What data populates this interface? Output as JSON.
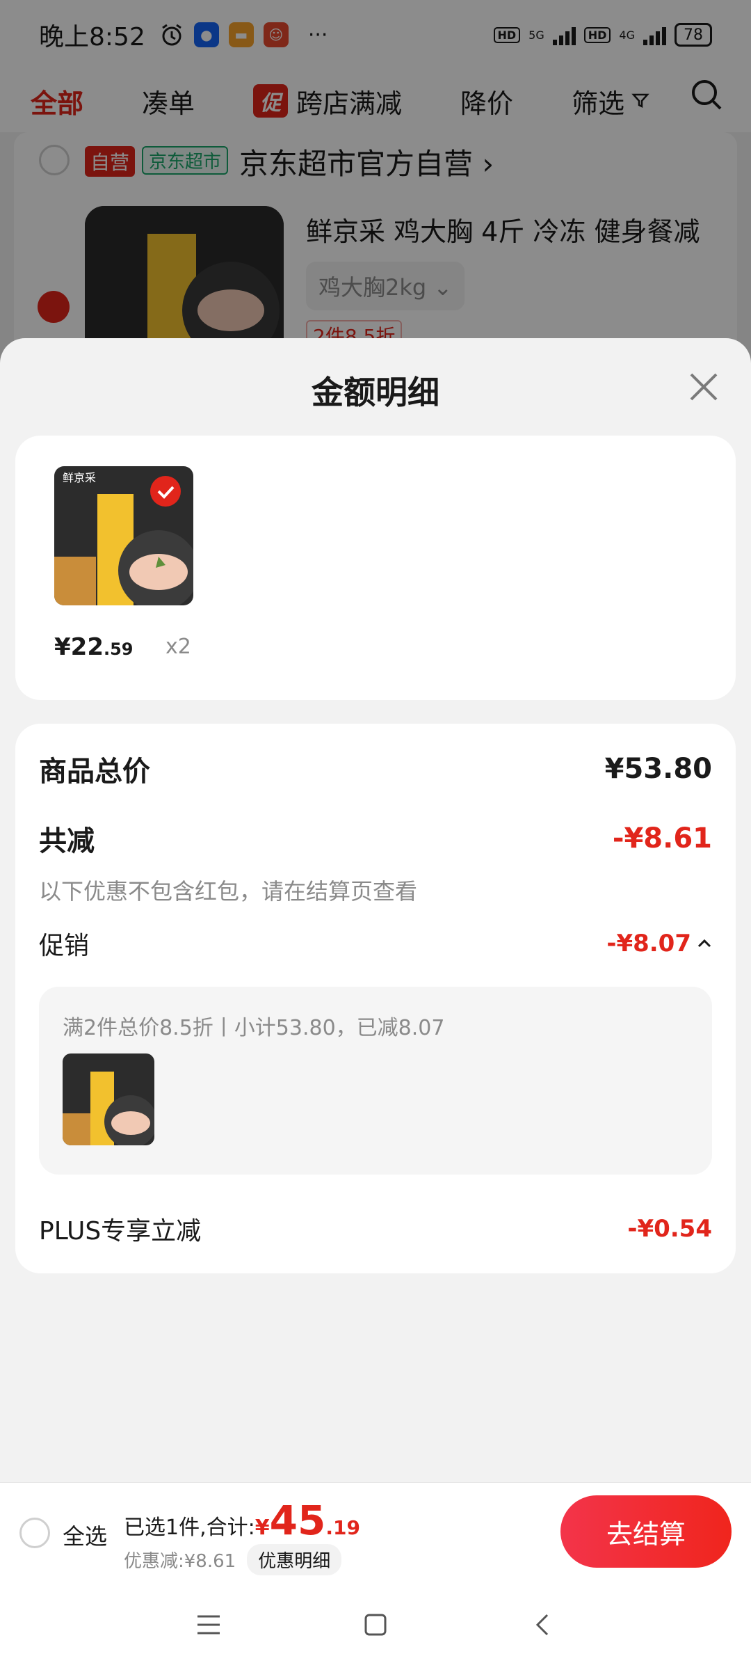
{
  "status_bar": {
    "time": "晚上8:52",
    "more": "···",
    "hd1": "HD",
    "net1": "5G",
    "hd2": "HD",
    "net2": "4G",
    "battery": "78"
  },
  "tabs": {
    "all": "全部",
    "combine": "凑单",
    "promo_badge": "促",
    "cross_store": "跨店满减",
    "price_drop": "降价",
    "filter": "筛选"
  },
  "background": {
    "tag_self": "自营",
    "tag_market": "京东超市",
    "store_name": "京东超市官方自营 ›",
    "product_title": "鲜京采 鸡大胸 4斤 冷冻 健身餐减",
    "spec": "鸡大胸2kg ⌄",
    "discount": "2件8.5折"
  },
  "sheet": {
    "title": "金额明细",
    "product": {
      "brand_mark": "鲜京采",
      "price_main": "¥22",
      "price_decimal": ".59",
      "qty": "x2"
    },
    "summary": {
      "total_label": "商品总价",
      "total_value": "¥53.80",
      "reduce_label": "共减",
      "reduce_value": "-¥8.61",
      "note": "以下优惠不包含红包，请在结算页查看",
      "promo_label": "促销",
      "promo_value": "-¥8.07",
      "promo_detail": "满2件总价8.5折丨小计53.80，已减8.07",
      "plus_label": "PLUS专享立减",
      "plus_value": "-¥0.54"
    }
  },
  "bottom_bar": {
    "select_all": "全选",
    "selected_text": "已选1件,合计:",
    "total_currency": "¥",
    "total_main": "45",
    "total_decimal": ".19",
    "discount_text": "优惠减:¥8.61",
    "detail_button": "优惠明细",
    "checkout": "去结算"
  },
  "colors": {
    "accent": "#e1251b",
    "checkout_gradient": [
      "#f3344a",
      "#f0251d"
    ]
  }
}
